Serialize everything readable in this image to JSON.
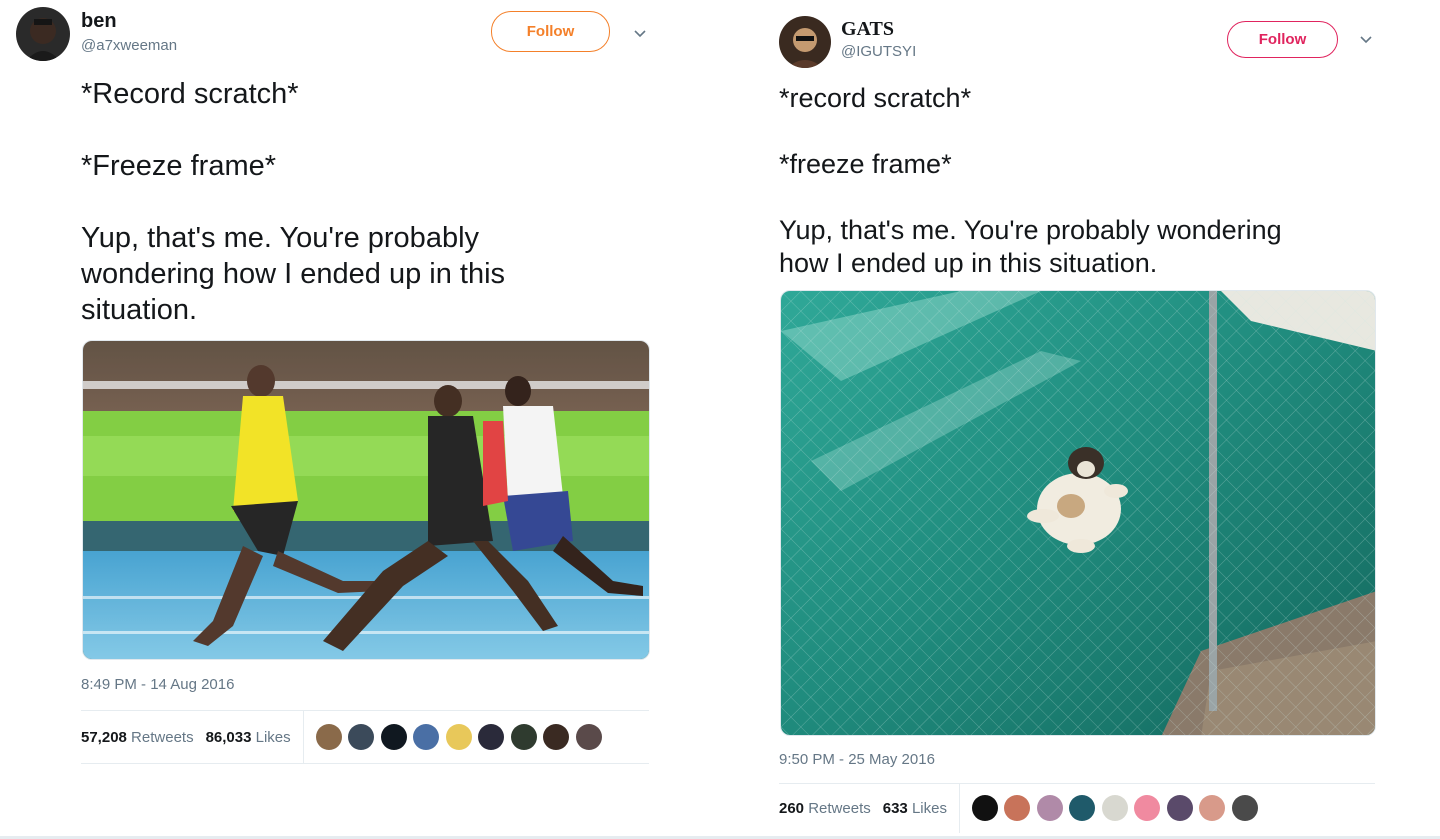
{
  "tweets": [
    {
      "user": {
        "name": "ben",
        "handle": "@a7xweeman"
      },
      "follow_label": "Follow",
      "text": "*Record scratch*\n\n*Freeze frame*\n\nYup, that's me. You're probably\nwondering how I ended up in this\nsituation.",
      "timestamp": "8:49 PM - 14 Aug 2016",
      "retweets": {
        "count": "57,208",
        "label": "Retweets"
      },
      "likes": {
        "count": "86,033",
        "label": "Likes"
      },
      "accent": "#f4802a"
    },
    {
      "user": {
        "name": "GATS",
        "handle": "@IGUTSYI"
      },
      "follow_label": "Follow",
      "text": "*record scratch*\n\n*freeze frame*\n\nYup, that's me. You're probably wondering\nhow I ended up in this situation.",
      "timestamp": "9:50 PM - 25 May 2016",
      "retweets": {
        "count": "260",
        "label": "Retweets"
      },
      "likes": {
        "count": "633",
        "label": "Likes"
      },
      "accent": "#e0245e"
    }
  ],
  "icons": {
    "more": "chevron-down-icon"
  }
}
